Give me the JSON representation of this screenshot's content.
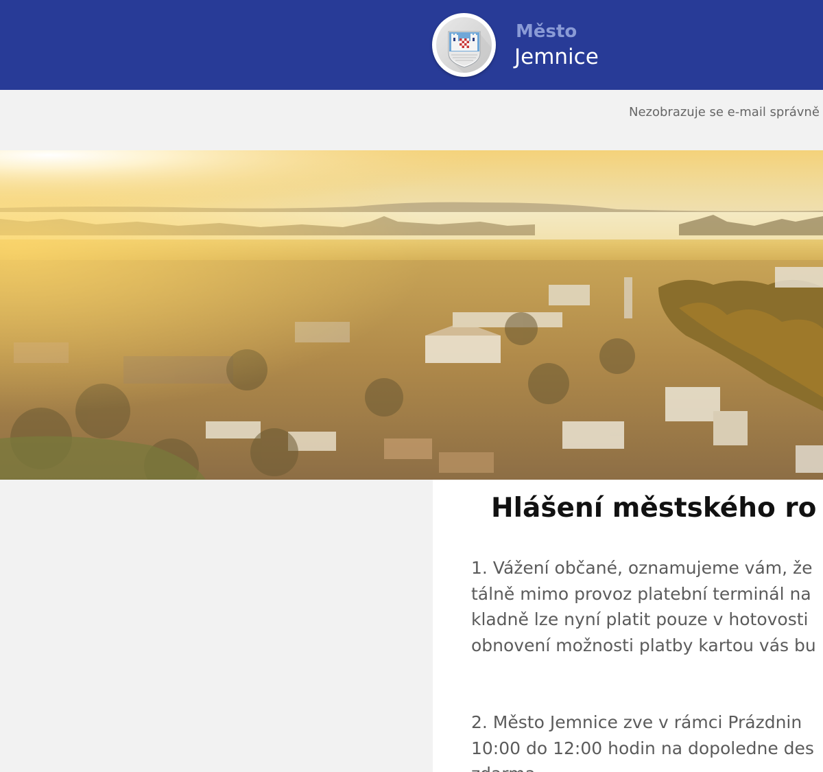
{
  "header": {
    "brand_top": "Město",
    "brand_bottom": "Jemnice",
    "logo": "coat-of-arms-icon",
    "background_color": "#283b97"
  },
  "email_notice": "Nezobrazuje se e-mail správně",
  "hero": {
    "image": "aerial town panorama at sunrise"
  },
  "announcement": {
    "title": "Hlášení městského ro",
    "paragraph1": [
      "1. Vážení občané, oznamujeme vám, že",
      "tálně mimo provoz platební terminál na",
      "kladně lze nyní platit pouze v hotovosti",
      "obnovení možnosti platby kartou vás bu"
    ],
    "paragraph2": [
      "2. Město Jemnice zve v rámci Prázdnin",
      "10:00 do 12:00 hodin na dopoledne des",
      "zdarma."
    ]
  }
}
